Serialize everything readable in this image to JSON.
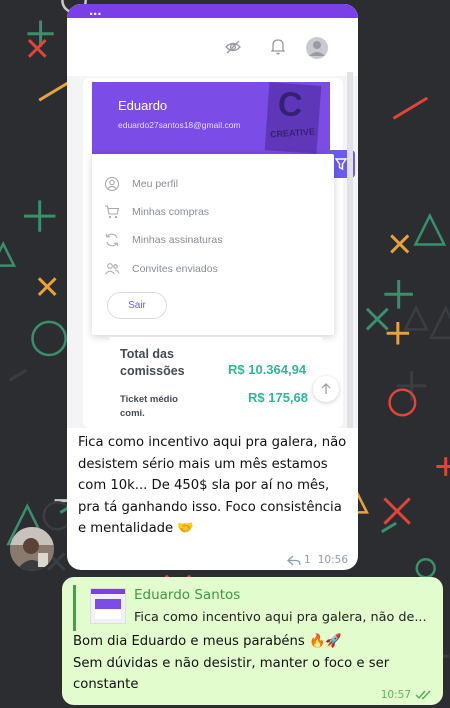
{
  "screenshot": {
    "logo": "...",
    "user_name": "Eduardo",
    "user_email": "eduardo27santos18@gmail.com",
    "book_letter": "C",
    "book_word": "CREATIVE",
    "breadcrumb": "",
    "menu": [
      {
        "label": "Meu perfil",
        "icon": "user-icon"
      },
      {
        "label": "Minhas compras",
        "icon": "cart-icon"
      },
      {
        "label": "Minhas assinaturas",
        "icon": "refresh-icon"
      },
      {
        "label": "Convites enviados",
        "icon": "people-icon"
      }
    ],
    "logout_label": "Sair",
    "stats": {
      "total_label_line1": "Total das",
      "total_label_line2": "comissões",
      "total_value": "R$ 10.364,94",
      "ticket_label_line1": "Ticket médio",
      "ticket_label_line2": "comi.",
      "ticket_value": "R$ 175,68"
    }
  },
  "incoming": {
    "text": "Fica como incentivo aqui pra galera, não desistem sério mais um mês estamos com 10k... De 450$ sla por aí no mês, pra tá ganhando isso. Foco consistência e mentalidade 🤝",
    "replies": "1",
    "time": "10:56"
  },
  "outgoing": {
    "reply_author": "Eduardo Santos",
    "reply_preview": "Fica como incentivo aqui pra galera, não de...",
    "line1": "Bom dia Eduardo e meus parabéns 🔥🚀",
    "line2": "Sem dúvidas e não desistir, manter o foco e ser constante",
    "time": "10:57",
    "status": "read-double-check"
  },
  "colors": {
    "bubble_in": "#ffffff",
    "bubble_out": "#e3fccd",
    "brand_purple": "#7c4ce6",
    "money_green": "#32b59a",
    "chat_bg": "#2a2c2e"
  }
}
